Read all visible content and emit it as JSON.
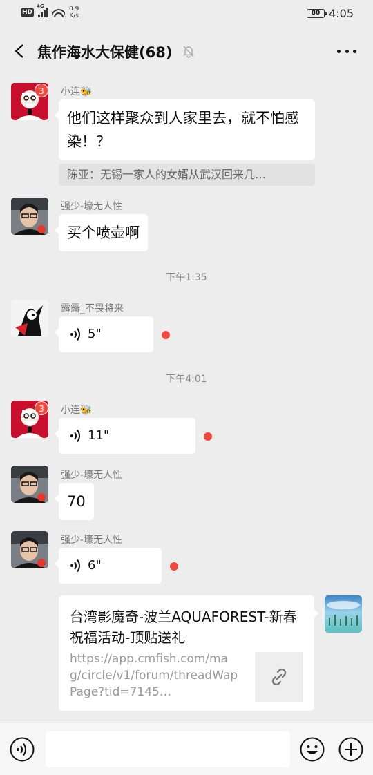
{
  "status_bar": {
    "hd": "HD",
    "network": "4G",
    "speed_value": "0.9",
    "speed_unit": "K/s",
    "battery": "80",
    "time": "4:05"
  },
  "header": {
    "title": "焦作海水大保健(68)"
  },
  "messages": [
    {
      "sender": "小连🐝",
      "badge": "3",
      "text": "他们这样聚众到人家里去，就不怕感染！？",
      "quote": "陈亚：无锡一家人的女婿从武汉回来几…"
    },
    {
      "sender": "强少-壕无人性",
      "text": "买个喷壶啊"
    },
    {
      "time": "下午1:35"
    },
    {
      "sender": "露露_不畏将来",
      "voice": "5\""
    },
    {
      "time": "下午4:01"
    },
    {
      "sender": "小连🐝",
      "badge": "3",
      "voice": "11\""
    },
    {
      "sender": "强少-壕无人性",
      "text": "70"
    },
    {
      "sender": "强少-壕无人性",
      "voice": "6\""
    }
  ],
  "link_card": {
    "title": "台湾影魔奇-波兰AQUAFOREST-新春祝福活动-顶贴送礼",
    "url": "https://app.cmfish.com/mag/circle/v1/forum/threadWapPage?tid=7145…"
  },
  "colors": {
    "background": "#ededed",
    "bubble": "#ffffff",
    "unread_dot": "#f0483e",
    "badge": "#f0483e"
  },
  "icons": {
    "back": "chevron-left-icon",
    "mute": "bell-off-icon",
    "more": "more-icon",
    "voice": "voice-wave-icon",
    "link": "link-icon",
    "emoji": "smile-icon",
    "plus": "plus-icon"
  }
}
